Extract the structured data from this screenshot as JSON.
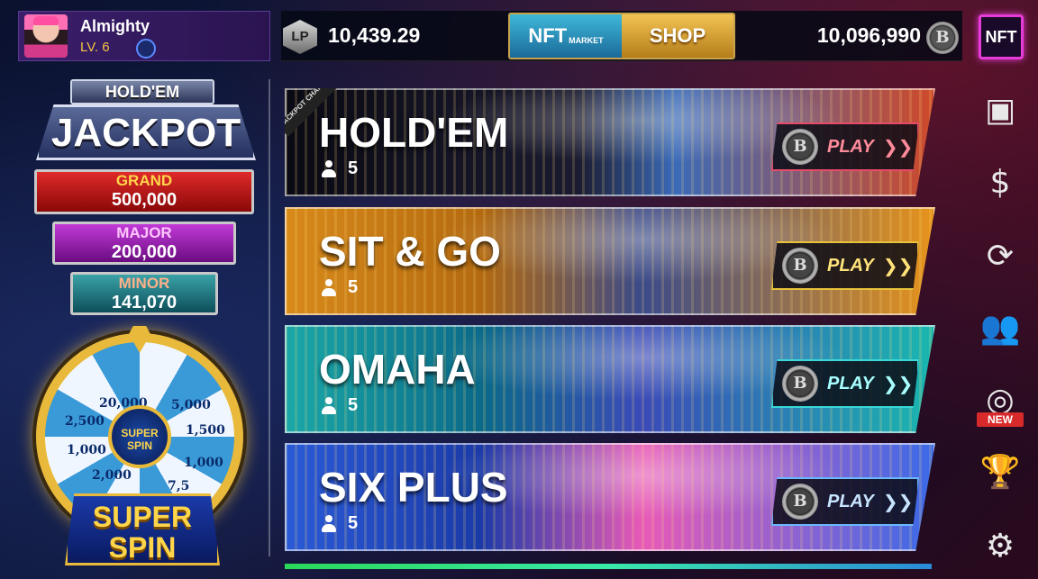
{
  "profile": {
    "name": "Almighty",
    "level": "LV. 6"
  },
  "topbar": {
    "lp_label": "LP",
    "lp_value": "10,439.29",
    "nft_label": "NFT",
    "nft_sub": "MARKET",
    "shop_label": "SHOP",
    "coin_value": "10,096,990",
    "coin_symbol": "B",
    "nft_button": "NFT"
  },
  "jackpot": {
    "header": "HOLD'EM",
    "title": "JACKPOT",
    "grand": {
      "label": "GRAND",
      "value": "500,000"
    },
    "major": {
      "label": "MAJOR",
      "value": "200,000"
    },
    "minor": {
      "label": "MINOR",
      "value": "141,070"
    }
  },
  "wheel": {
    "segments": [
      "20,000",
      "5,000",
      "1,500",
      "1,000",
      "7,5",
      "2,000",
      "1,000",
      "2,500"
    ],
    "hub_label": "SUPER SPIN",
    "button_label": "SUPER SPIN"
  },
  "modes": [
    {
      "title": "HOLD'EM",
      "players": "5",
      "play": "PLAY",
      "ribbon": "JACKPOT CHANCE"
    },
    {
      "title": "SIT & GO",
      "players": "5",
      "play": "PLAY"
    },
    {
      "title": "OMAHA",
      "players": "5",
      "play": "PLAY"
    },
    {
      "title": "SIX PLUS",
      "players": "5",
      "play": "PLAY"
    }
  ],
  "rail": {
    "icons": [
      "box-icon",
      "cash-hand-icon",
      "exchange-icon",
      "friends-icon",
      "target-icon",
      "trophy-icon",
      "gear-icon"
    ],
    "new_tag": "NEW"
  },
  "colors": {
    "accent_gold": "#e8b93a",
    "nft_pink": "#e63bd6",
    "grand_red": "#e02a2a",
    "major_purple": "#c23ad8",
    "minor_teal": "#3aa2a8"
  }
}
